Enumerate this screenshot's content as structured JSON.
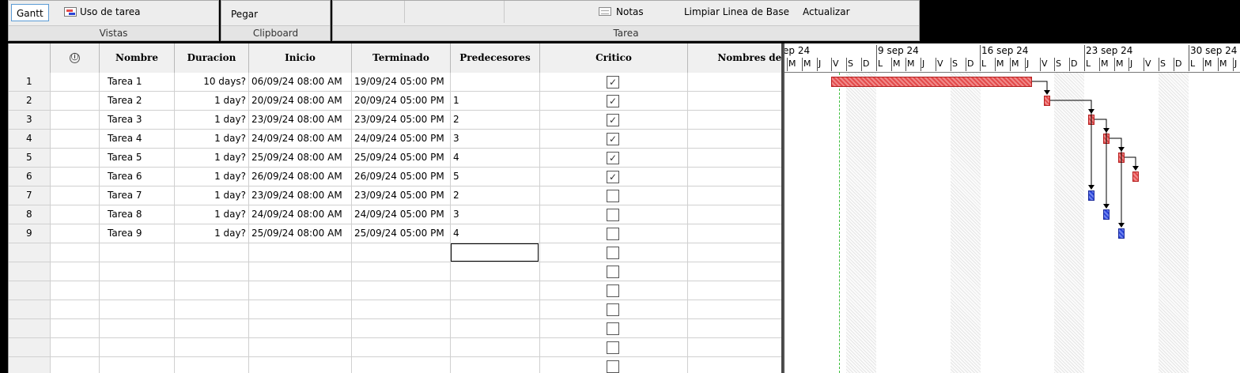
{
  "ribbon": {
    "views": {
      "gantt_label": "Gantt",
      "usage_label": "Uso de tarea",
      "group_label": "Vistas"
    },
    "clipboard": {
      "paste_label": "Pegar",
      "group_label": "Clipboard"
    },
    "task": {
      "notes_label": "Notas",
      "clear_baseline_label": "Limpiar Linea de Base",
      "update_label": "Actualizar",
      "group_label": "Tarea"
    }
  },
  "table": {
    "headers": {
      "info": "ⓘ",
      "name": "Nombre",
      "duration": "Duracion",
      "start": "Inicio",
      "finish": "Terminado",
      "predecessors": "Predecesores",
      "critical": "Critico",
      "resources": "Nombres del R"
    },
    "rows": [
      {
        "id": "1",
        "name": "Tarea 1",
        "duration": "10 days?",
        "start": "06/09/24 08:00 AM",
        "finish": "19/09/24 05:00 PM",
        "pred": "",
        "critical": true
      },
      {
        "id": "2",
        "name": "Tarea 2",
        "duration": "1 day?",
        "start": "20/09/24 08:00 AM",
        "finish": "20/09/24 05:00 PM",
        "pred": "1",
        "critical": true
      },
      {
        "id": "3",
        "name": "Tarea 3",
        "duration": "1 day?",
        "start": "23/09/24 08:00 AM",
        "finish": "23/09/24 05:00 PM",
        "pred": "2",
        "critical": true
      },
      {
        "id": "4",
        "name": "Tarea 4",
        "duration": "1 day?",
        "start": "24/09/24 08:00 AM",
        "finish": "24/09/24 05:00 PM",
        "pred": "3",
        "critical": true
      },
      {
        "id": "5",
        "name": "Tarea 5",
        "duration": "1 day?",
        "start": "25/09/24 08:00 AM",
        "finish": "25/09/24 05:00 PM",
        "pred": "4",
        "critical": true
      },
      {
        "id": "6",
        "name": "Tarea 6",
        "duration": "1 day?",
        "start": "26/09/24 08:00 AM",
        "finish": "26/09/24 05:00 PM",
        "pred": "5",
        "critical": true
      },
      {
        "id": "7",
        "name": "Tarea 7",
        "duration": "1 day?",
        "start": "23/09/24 08:00 AM",
        "finish": "23/09/24 05:00 PM",
        "pred": "2",
        "critical": false
      },
      {
        "id": "8",
        "name": "Tarea 8",
        "duration": "1 day?",
        "start": "24/09/24 08:00 AM",
        "finish": "24/09/24 05:00 PM",
        "pred": "3",
        "critical": false
      },
      {
        "id": "9",
        "name": "Tarea 9",
        "duration": "1 day?",
        "start": "25/09/24 08:00 AM",
        "finish": "25/09/24 05:00 PM",
        "pred": "4",
        "critical": false
      }
    ],
    "empty_row_count": 7
  },
  "gantt": {
    "weeks": [
      "ep 24",
      "9 sep 24",
      "16 sep 24",
      "23 sep 24",
      "30 sep 24"
    ],
    "day_letters": [
      "M",
      "M",
      "J",
      "V",
      "S",
      "D",
      "L"
    ],
    "colors": {
      "critical": "#e34b4b",
      "normal": "#2b44d6",
      "today": "#3cbf3c"
    }
  }
}
